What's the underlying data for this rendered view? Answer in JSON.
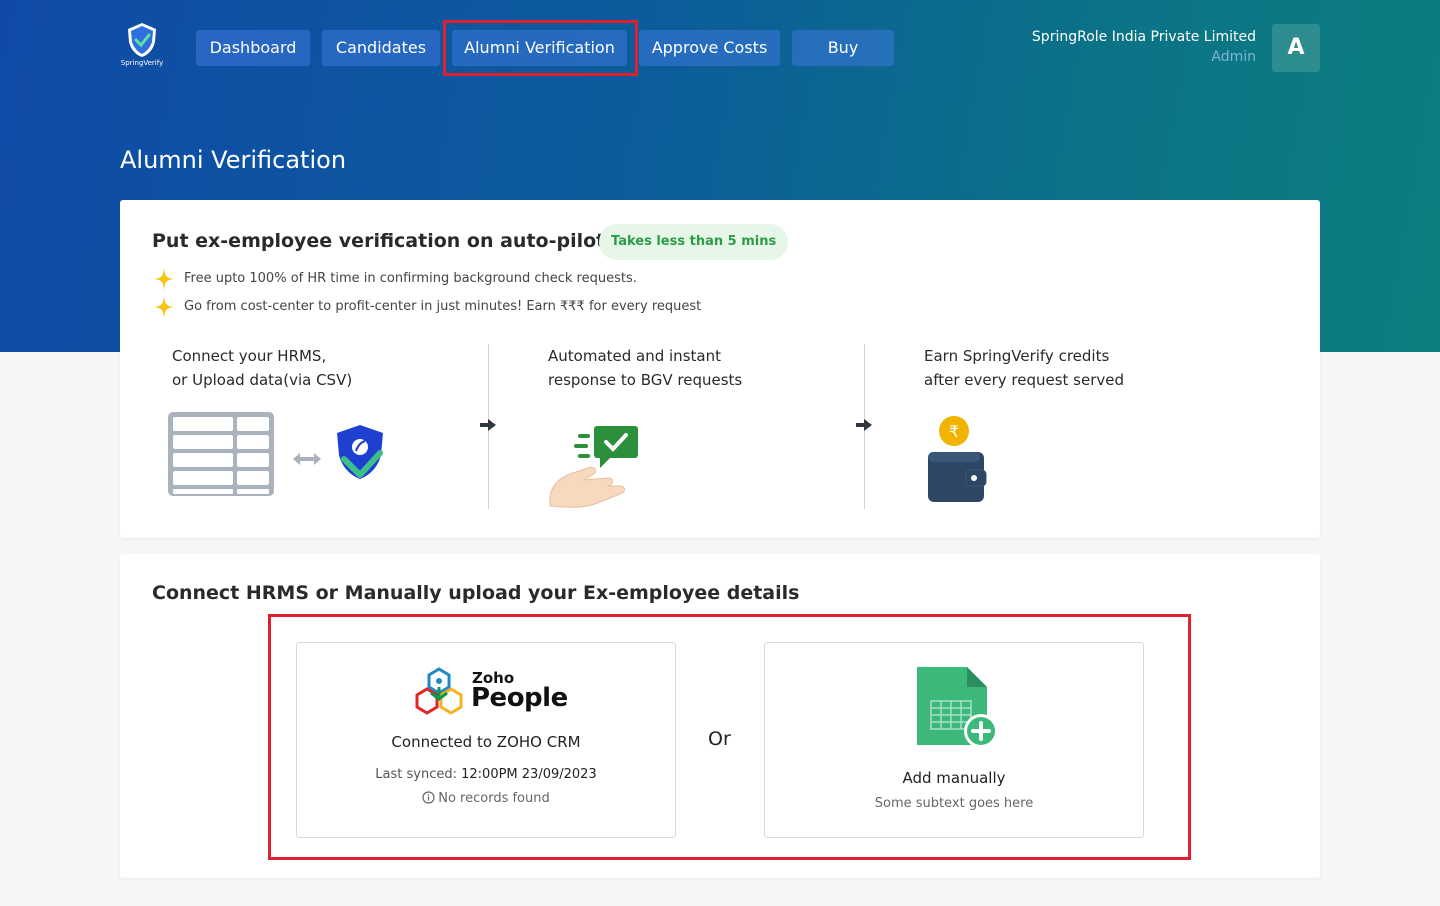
{
  "header": {
    "logo_text": "SpringVerify",
    "nav": [
      {
        "label": "Dashboard",
        "active": false
      },
      {
        "label": "Candidates",
        "active": false
      },
      {
        "label": "Alumni Verification",
        "active": true
      },
      {
        "label": "Approve Costs",
        "active": false
      },
      {
        "label": "Buy",
        "active": false
      }
    ],
    "company_name": "SpringRole India Private Limited",
    "role": "Admin",
    "avatar_letter": "A"
  },
  "page_title": "Alumni Verification",
  "intro": {
    "title": "Put ex-employee verification on auto-pilot",
    "badge": "Takes less than 5 mins",
    "bullets": [
      "Free upto 100% of HR time in confirming background check requests.",
      "Go from cost-center to profit-center in just minutes! Earn ₹₹₹ for every request"
    ],
    "steps": [
      {
        "line1": "Connect your HRMS,",
        "line2": "or Upload data(via CSV)"
      },
      {
        "line1": "Automated and instant",
        "line2": "response to BGV requests"
      },
      {
        "line1": "Earn SpringVerify credits",
        "line2": "after every request served"
      }
    ]
  },
  "connect": {
    "title": "Connect HRMS or Manually upload your Ex-employee details",
    "zoho": {
      "brand_small": "Zoho",
      "brand_big": "People",
      "status": "Connected to ZOHO CRM",
      "sync_label": "Last synced:",
      "sync_value": "12:00PM 23/09/2023",
      "records": "No records found"
    },
    "or_label": "Or",
    "manual": {
      "title": "Add manually",
      "subtitle": "Some subtext goes here"
    }
  },
  "colors": {
    "accent_red": "#e0202e",
    "badge_green": "#2e9b47",
    "sheet_green": "#3cb87a"
  }
}
